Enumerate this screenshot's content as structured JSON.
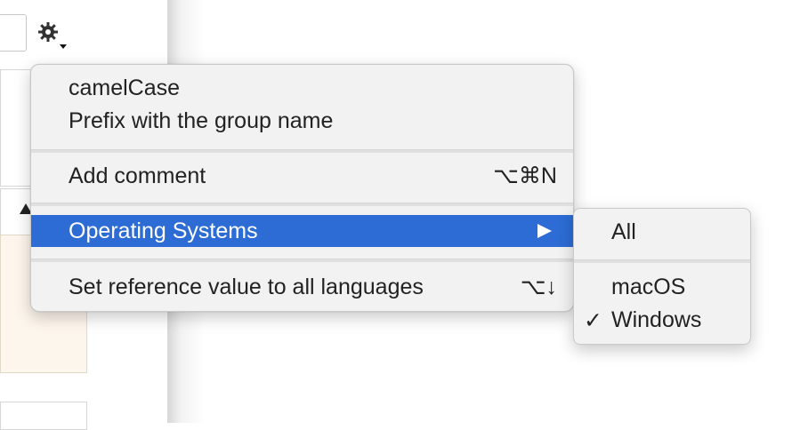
{
  "menu": {
    "items": [
      {
        "label": "camelCase",
        "shortcut": ""
      },
      {
        "label": "Prefix with the group name",
        "shortcut": ""
      },
      {
        "label": "Add comment",
        "shortcut": "⌥⌘N"
      },
      {
        "label": "Operating Systems",
        "shortcut": "",
        "selected": true,
        "has_submenu": true
      },
      {
        "label": "Set reference value to all languages",
        "shortcut": "⌥↓"
      }
    ],
    "highlight_color": "#2c6cd4"
  },
  "submenu": {
    "items": [
      {
        "label": "All",
        "checked": false
      },
      {
        "label": "macOS",
        "checked": false
      },
      {
        "label": "Windows",
        "checked": true,
        "check_glyph": "✓"
      }
    ]
  },
  "icons": [
    "gear-icon",
    "chevron-down-icon",
    "submenu-arrow-icon",
    "checkmark-icon",
    "warning-triangle-icon"
  ]
}
